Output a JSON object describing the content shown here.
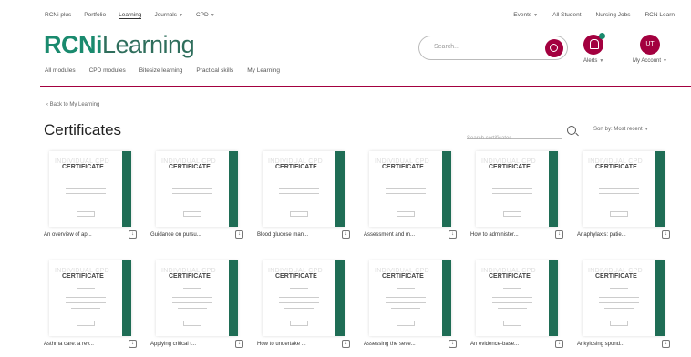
{
  "topbar": {
    "left": [
      "RCNi plus",
      "Portfolio",
      "Learning",
      "Journals",
      "CPD"
    ],
    "right": [
      "Events",
      "All Student",
      "Nursing Jobs",
      "RCN Learn"
    ]
  },
  "brand": {
    "part1": "RCNi",
    "part2": "Learning"
  },
  "search": {
    "placeholder": "Search..."
  },
  "alerts_label": "Alerts",
  "account": {
    "initials": "UT",
    "label": "My Account"
  },
  "subnav": [
    "All modules",
    "CPD modules",
    "Bitesize learning",
    "Practical skills",
    "My Learning"
  ],
  "back_link": "‹ Back to My Learning",
  "page_title": "Certificates",
  "cert_search": {
    "placeholder": "Search certificates"
  },
  "sort": "Sort by: Most recent",
  "cert_thumb": {
    "faint": "INDIVIDUAL CPD",
    "heading": "CERTIFICATE"
  },
  "certificates": [
    "An overview of ap...",
    "Guidance on pursu...",
    "Blood glucose man...",
    "Assessment and m...",
    "How to administer...",
    "Anaphylaxis: patie...",
    "Asthma care: a rev...",
    "Applying critical t...",
    "How to undertake ...",
    "Assessing the seve...",
    "An evidence-base...",
    "Ankylosing spond..."
  ],
  "colors": {
    "accent": "#a3003f",
    "brand": "#1a8a6e",
    "stripe": "#1f6d55"
  }
}
